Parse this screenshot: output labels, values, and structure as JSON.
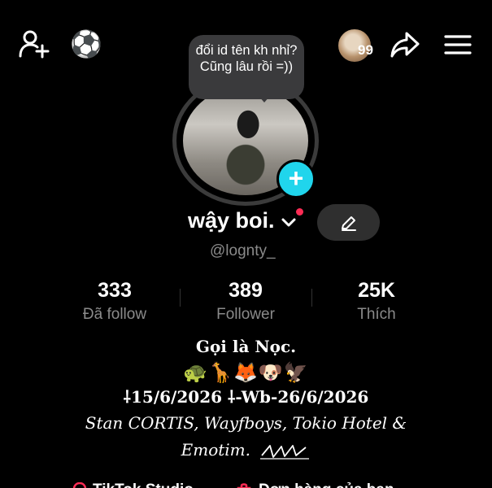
{
  "header": {
    "icons": {
      "add_friend": "person-plus-icon",
      "soccer": "soccer-ball-icon",
      "share": "share-arrow-icon",
      "menu": "hamburger-menu-icon"
    },
    "soccer_glyph": "⚽",
    "friends_count": "99"
  },
  "profile": {
    "note": "đổi id tên kh nhỉ? Cũng lâu rồi =))",
    "username": "wậy boi.",
    "handle": "@lognty_",
    "stats": [
      {
        "value": "333",
        "label": "Đã follow"
      },
      {
        "value": "389",
        "label": "Follower"
      },
      {
        "value": "25K",
        "label": "Thích"
      }
    ]
  },
  "bio": {
    "line1": "Gọi là Nọc.",
    "line2": "🐢🦒🦊🐶🦅",
    "line3": "⸸15/6/2026 ⸸-Wb-26/6/2026",
    "line4": "Stan CORTIS, Wayfboys, Tokio Hotel &",
    "line5": "Emotim."
  },
  "bottom_row": {
    "item1": "TikTok Studio",
    "item2": "Đơn hàng của bạn"
  },
  "colors": {
    "accent_cyan": "#20d5ec",
    "notification_red": "#fe2c55",
    "muted_text": "#8a8a8a",
    "bubble_bg": "#3a3a3c"
  }
}
